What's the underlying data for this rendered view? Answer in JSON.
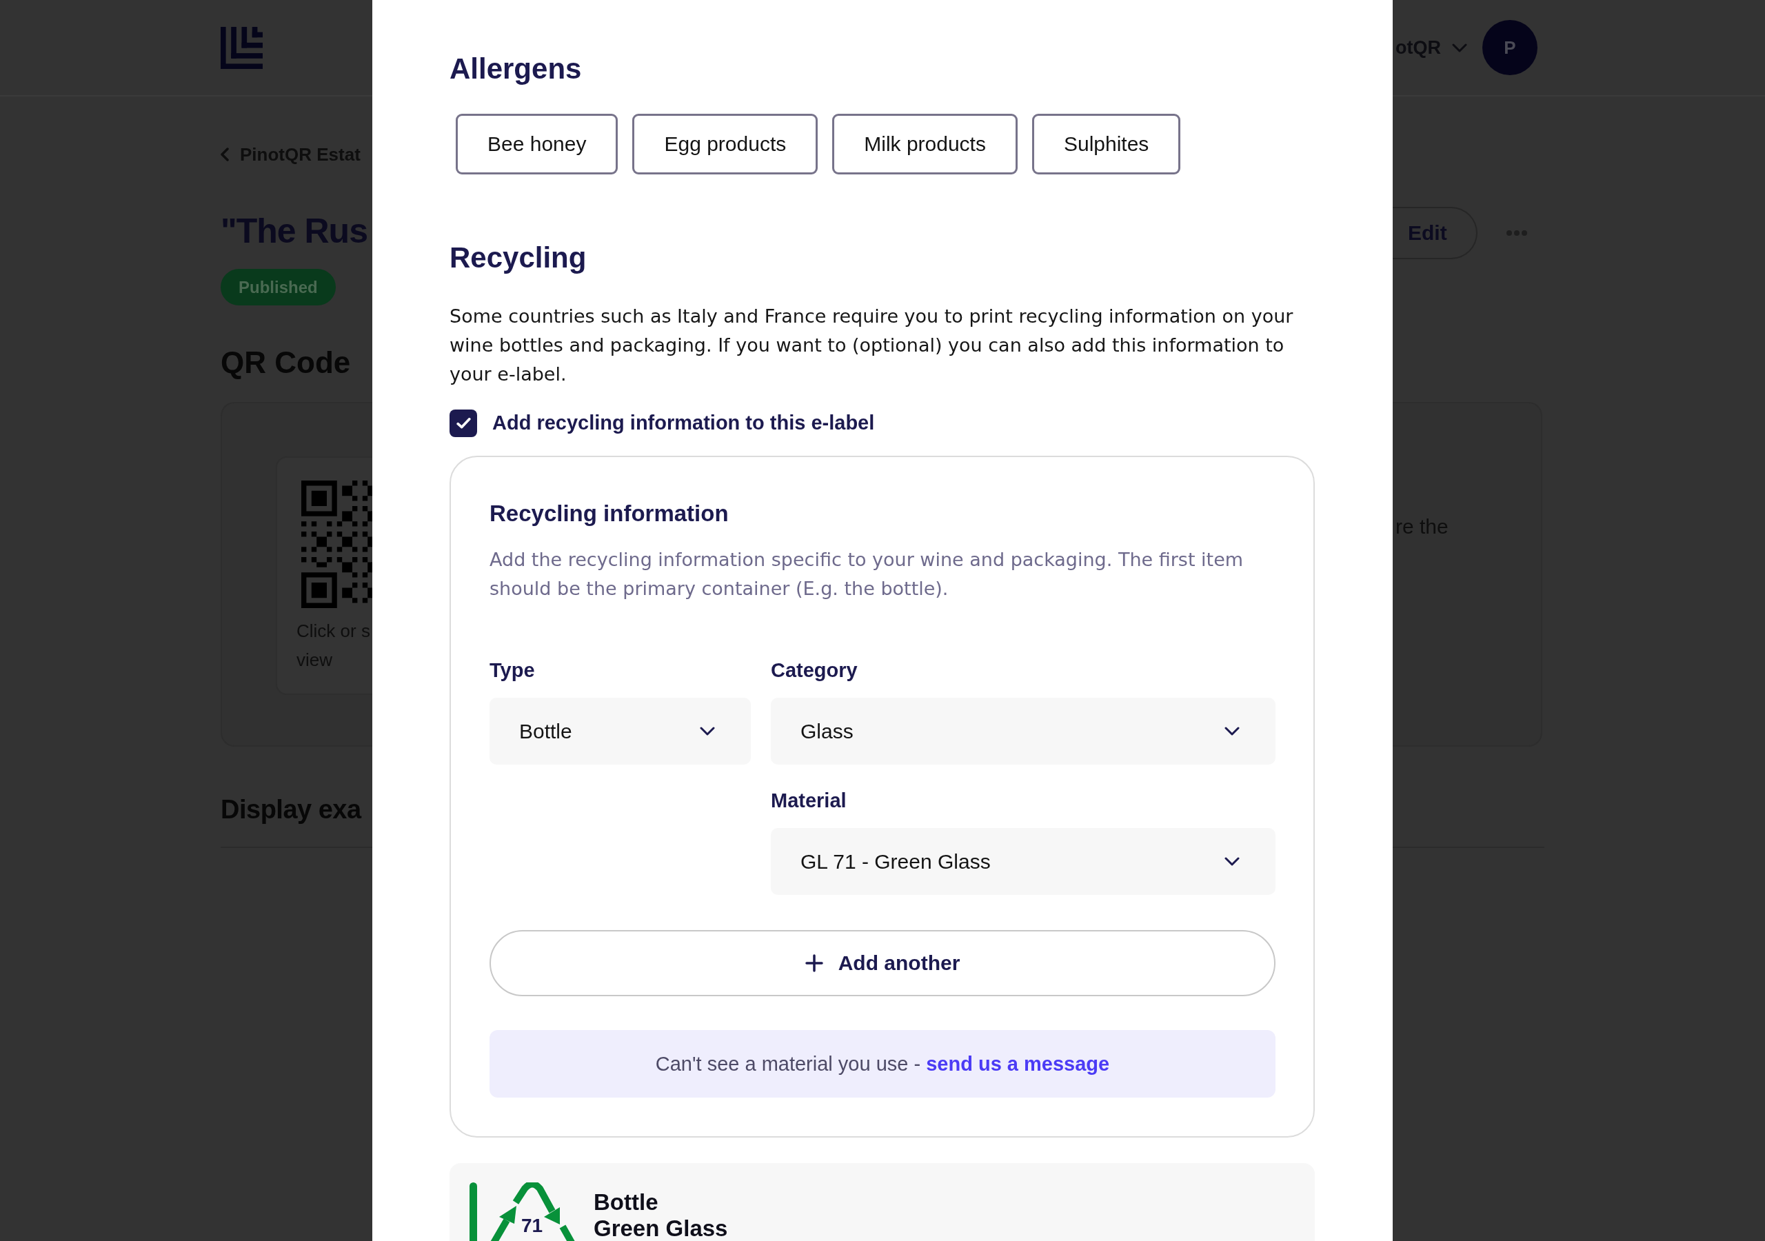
{
  "background_page": {
    "header": {
      "account_name": "otQR",
      "avatar_initial": "P"
    },
    "breadcrumb": "PinotQR Estat",
    "title": "\"The Rus",
    "status_badge": "Published",
    "edit_button": "Edit",
    "qr_section": {
      "heading": "QR Code",
      "caption_lines": [
        "Click or s",
        "view"
      ],
      "side_text": "re the"
    },
    "display_heading": "Display exa"
  },
  "modal": {
    "allergens": {
      "heading": "Allergens",
      "items": [
        {
          "label": "Bee honey"
        },
        {
          "label": "Egg products"
        },
        {
          "label": "Milk products"
        },
        {
          "label": "Sulphites"
        }
      ]
    },
    "recycling": {
      "heading": "Recycling",
      "description": "Some countries such as Italy and France require you to print recycling information on your wine bottles and packaging. If you want to (optional) you can also add this information to your e-label.",
      "opt_in": {
        "label": "Add recycling information to this e-label",
        "checked": true
      },
      "info_card": {
        "title": "Recycling information",
        "description": "Add the recycling information specific to your wine and packaging. The first item should be the primary container (E.g. the bottle).",
        "fields": [
          {
            "label": "Type",
            "value": "Bottle"
          },
          {
            "label": "Category",
            "value": "Glass"
          },
          {
            "label": "Material",
            "value": "GL 71 - Green Glass"
          }
        ],
        "add_button": "Add another",
        "notice": {
          "text": "Can't see a material you use - ",
          "link": "send us a message"
        }
      },
      "preview": [
        {
          "code": "71",
          "type": "Bottle",
          "material": "Green Glass"
        }
      ]
    }
  }
}
